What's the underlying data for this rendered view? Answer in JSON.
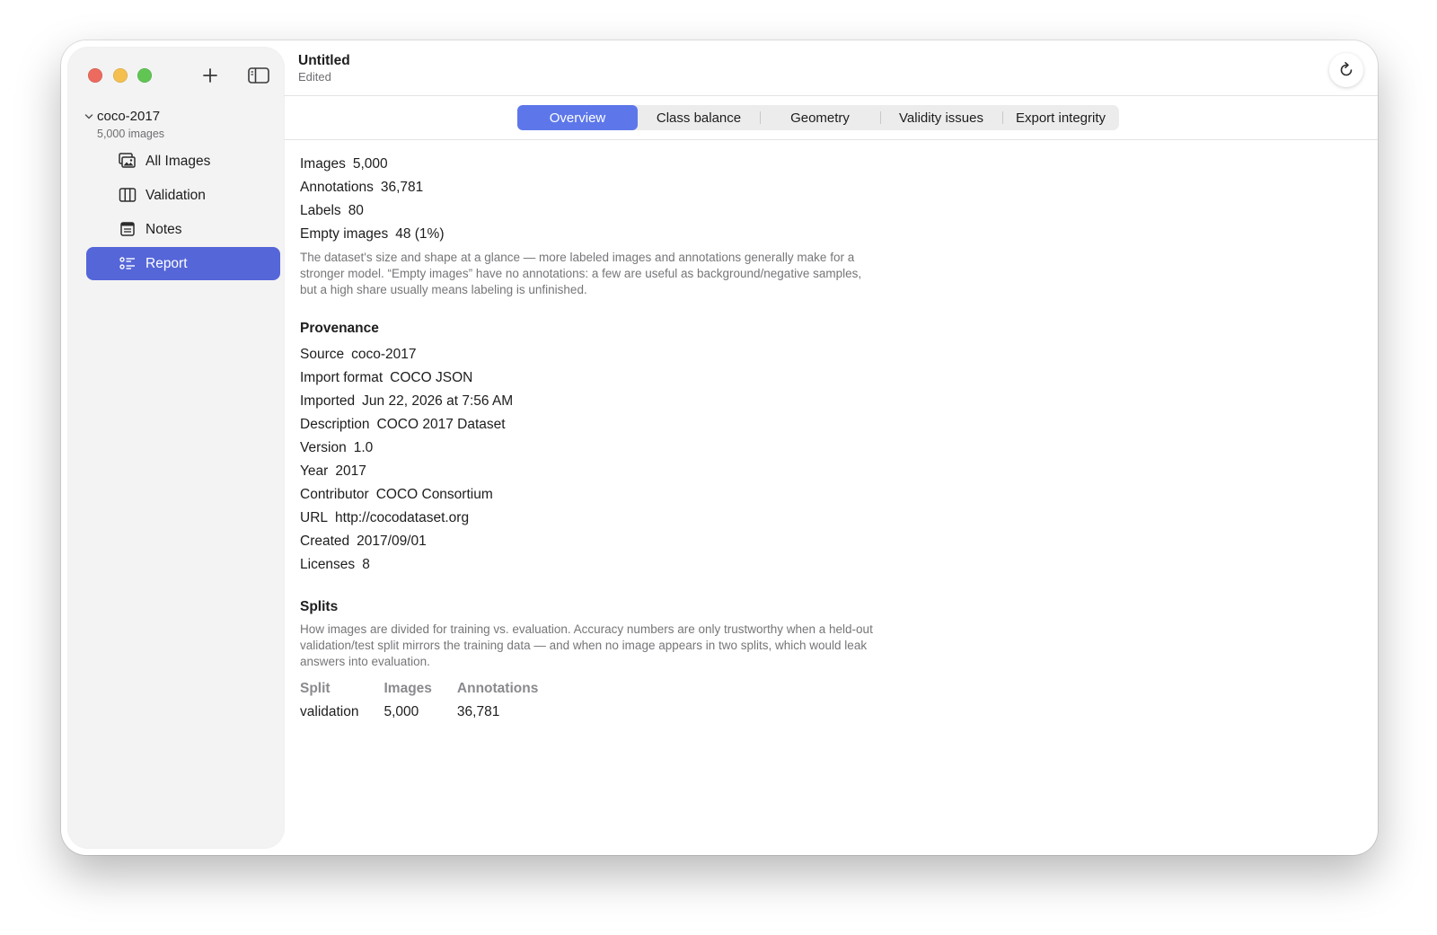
{
  "window": {
    "doc_title": "Untitled",
    "doc_subtitle": "Edited"
  },
  "sidebar": {
    "dataset_name": "coco-2017",
    "dataset_count": "5,000 images",
    "items": [
      {
        "label": "All Images",
        "icon": "photo-stack-icon",
        "active": false
      },
      {
        "label": "Validation",
        "icon": "columns-icon",
        "active": false
      },
      {
        "label": "Notes",
        "icon": "note-icon",
        "active": false
      },
      {
        "label": "Report",
        "icon": "list-icon",
        "active": true
      }
    ]
  },
  "tabs": [
    {
      "label": "Overview",
      "active": true
    },
    {
      "label": "Class balance",
      "active": false
    },
    {
      "label": "Geometry",
      "active": false
    },
    {
      "label": "Validity issues",
      "active": false
    },
    {
      "label": "Export integrity",
      "active": false
    }
  ],
  "overview": {
    "stats": [
      {
        "key": "Images",
        "value": "5,000"
      },
      {
        "key": "Annotations",
        "value": "36,781"
      },
      {
        "key": "Labels",
        "value": "80"
      },
      {
        "key": "Empty images",
        "value": "48 (1%)"
      }
    ],
    "help": "The dataset's size and shape at a glance — more labeled images and annotations generally make for a stronger model. “Empty images” have no annotations: a few are useful as background/negative samples, but a high share usually means labeling is unfinished."
  },
  "provenance": {
    "title": "Provenance",
    "rows": [
      {
        "key": "Source",
        "value": "coco-2017"
      },
      {
        "key": "Import format",
        "value": "COCO JSON"
      },
      {
        "key": "Imported",
        "value": "Jun 22, 2026 at 7:56 AM"
      },
      {
        "key": "Description",
        "value": "COCO 2017 Dataset"
      },
      {
        "key": "Version",
        "value": "1.0"
      },
      {
        "key": "Year",
        "value": "2017"
      },
      {
        "key": "Contributor",
        "value": "COCO Consortium"
      },
      {
        "key": "URL",
        "value": "http://cocodataset.org"
      },
      {
        "key": "Created",
        "value": "2017/09/01"
      },
      {
        "key": "Licenses",
        "value": "8"
      }
    ]
  },
  "splits": {
    "title": "Splits",
    "help": "How images are divided for training vs. evaluation. Accuracy numbers are only trustworthy when a held-out validation/test split mirrors the training data — and when no image appears in two splits, which would leak answers into evaluation.",
    "columns": [
      "Split",
      "Images",
      "Annotations"
    ],
    "rows": [
      [
        "validation",
        "5,000",
        "36,781"
      ]
    ]
  },
  "colors": {
    "accent": "#5d77ea",
    "sidebar_active": "#5566d8",
    "close": "#ec6a5e",
    "minimize": "#f4bf4f",
    "zoom": "#61c554"
  }
}
